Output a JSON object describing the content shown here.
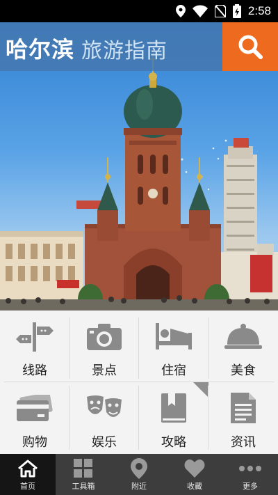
{
  "status_bar": {
    "time": "2:58"
  },
  "header": {
    "title_main": "哈尔滨",
    "title_sub": "旅游指南"
  },
  "colors": {
    "accent": "#ee6a1e",
    "title_bar": "#4678af",
    "nav_bg": "#3d3d3d",
    "nav_active": "#151515",
    "icon_gray": "#8a8a8a"
  },
  "menu": [
    {
      "label": "线路",
      "icon": "signpost-icon"
    },
    {
      "label": "景点",
      "icon": "camera-icon"
    },
    {
      "label": "住宿",
      "icon": "bed-icon"
    },
    {
      "label": "美食",
      "icon": "cloche-icon"
    },
    {
      "label": "购物",
      "icon": "credit-card-icon"
    },
    {
      "label": "娱乐",
      "icon": "theater-masks-icon"
    },
    {
      "label": "攻略",
      "icon": "bookmark-book-icon"
    },
    {
      "label": "资讯",
      "icon": "document-icon"
    }
  ],
  "bottom_nav": [
    {
      "label": "首页",
      "icon": "home-icon",
      "active": true
    },
    {
      "label": "工具箱",
      "icon": "grid-icon"
    },
    {
      "label": "附近",
      "icon": "location-pin-icon"
    },
    {
      "label": "收藏",
      "icon": "heart-icon"
    },
    {
      "label": "更多",
      "icon": "more-dots-icon"
    }
  ]
}
